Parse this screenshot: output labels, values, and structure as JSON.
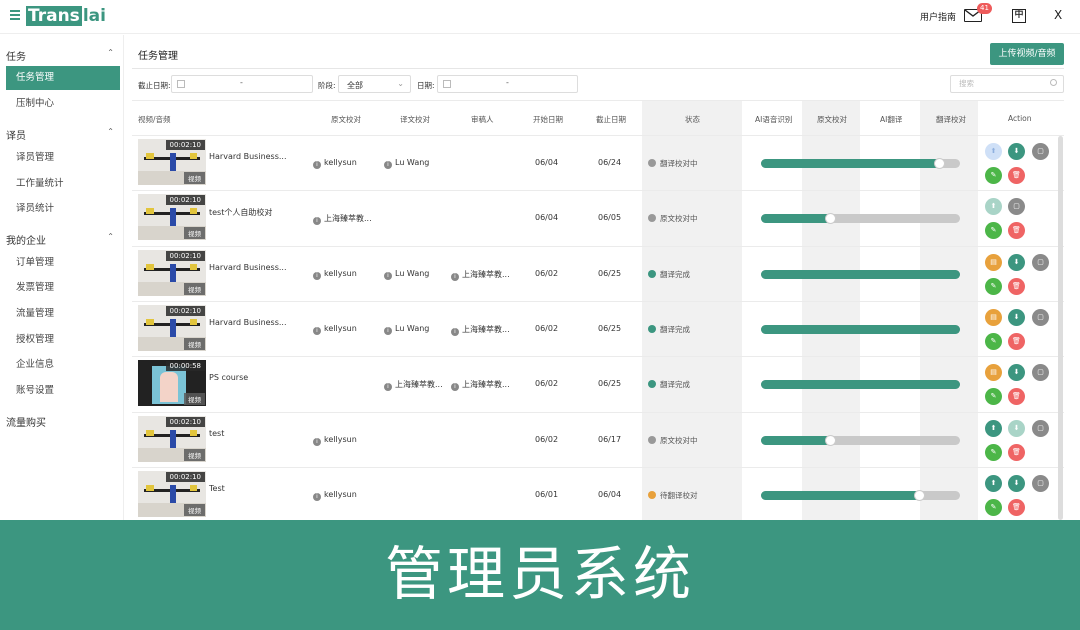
{
  "header": {
    "logo_box": "Trans",
    "logo_rest": "lai",
    "guide": "用户指南",
    "mail_badge": "41",
    "lang_label": "中",
    "x_label": "X"
  },
  "sidebar": {
    "groups": [
      {
        "label": "任务",
        "items": [
          "任务管理",
          "压制中心"
        ]
      },
      {
        "label": "译员",
        "items": [
          "译员管理",
          "工作量统计",
          "译员统计"
        ]
      },
      {
        "label": "我的企业",
        "items": [
          "订单管理",
          "发票管理",
          "流量管理",
          "授权管理",
          "企业信息",
          "账号设置"
        ]
      },
      {
        "label": "流量购买",
        "items": []
      }
    ],
    "active": "任务管理"
  },
  "main": {
    "title": "任务管理",
    "upload_button": "上传视频/音频",
    "filters": {
      "deadline_label": "截止日期:",
      "stage_label": "阶段:",
      "stage_value": "全部",
      "date_label": "日期:",
      "search_placeholder": "搜索",
      "range_sep": "-"
    },
    "columns": [
      "视频/音频",
      "原文校对",
      "译文校对",
      "审稿人",
      "开始日期",
      "截止日期",
      "状态",
      "AI语音识别",
      "原文校对",
      "AI翻译",
      "翻译校对",
      "Action"
    ],
    "thumb_tag": "视频",
    "rows": [
      {
        "duration": "00:02:10",
        "title": "Harvard Business...",
        "src_proof": "kellysun",
        "tgt_proof": "Lu Wang",
        "reviewer": "",
        "start": "06/04",
        "end": "06/24",
        "status": "翻译校对中",
        "status_color": "#999999",
        "progress": 0.9,
        "knob": true
      },
      {
        "duration": "00:02:10",
        "title": "test个人自助校对",
        "src_proof": "上海臻萃教...",
        "tgt_proof": "",
        "reviewer": "",
        "start": "06/04",
        "end": "06/05",
        "status": "原文校对中",
        "status_color": "#999999",
        "progress": 0.35,
        "knob": true
      },
      {
        "duration": "00:02:10",
        "title": "Harvard Business...",
        "src_proof": "kellysun",
        "tgt_proof": "Lu Wang",
        "reviewer": "上海臻萃教...",
        "start": "06/02",
        "end": "06/25",
        "status": "翻译完成",
        "status_color": "#3c9680",
        "progress": 1.0,
        "knob": false
      },
      {
        "duration": "00:02:10",
        "title": "Harvard Business...",
        "src_proof": "kellysun",
        "tgt_proof": "Lu Wang",
        "reviewer": "上海臻萃教...",
        "start": "06/02",
        "end": "06/25",
        "status": "翻译完成",
        "status_color": "#3c9680",
        "progress": 1.0,
        "knob": false
      },
      {
        "duration": "00:00:58",
        "title": "PS course",
        "src_proof": "",
        "tgt_proof": "上海臻萃教...",
        "reviewer": "上海臻萃教...",
        "start": "06/02",
        "end": "06/25",
        "status": "翻译完成",
        "status_color": "#3c9680",
        "progress": 1.0,
        "knob": false
      },
      {
        "duration": "00:02:10",
        "title": "test",
        "src_proof": "kellysun",
        "tgt_proof": "",
        "reviewer": "",
        "start": "06/02",
        "end": "06/17",
        "status": "原文校对中",
        "status_color": "#999999",
        "progress": 0.35,
        "knob": true
      },
      {
        "duration": "00:02:10",
        "title": "Test",
        "src_proof": "kellysun",
        "tgt_proof": "",
        "reviewer": "",
        "start": "06/01",
        "end": "06/04",
        "status": "待翻译校对",
        "status_color": "#e8a13c",
        "progress": 0.8,
        "knob": true
      }
    ]
  },
  "banner": {
    "text": "管理员系统"
  },
  "colors": {
    "accent": "#3c9680",
    "danger": "#ef6464",
    "success": "#4cb648"
  }
}
